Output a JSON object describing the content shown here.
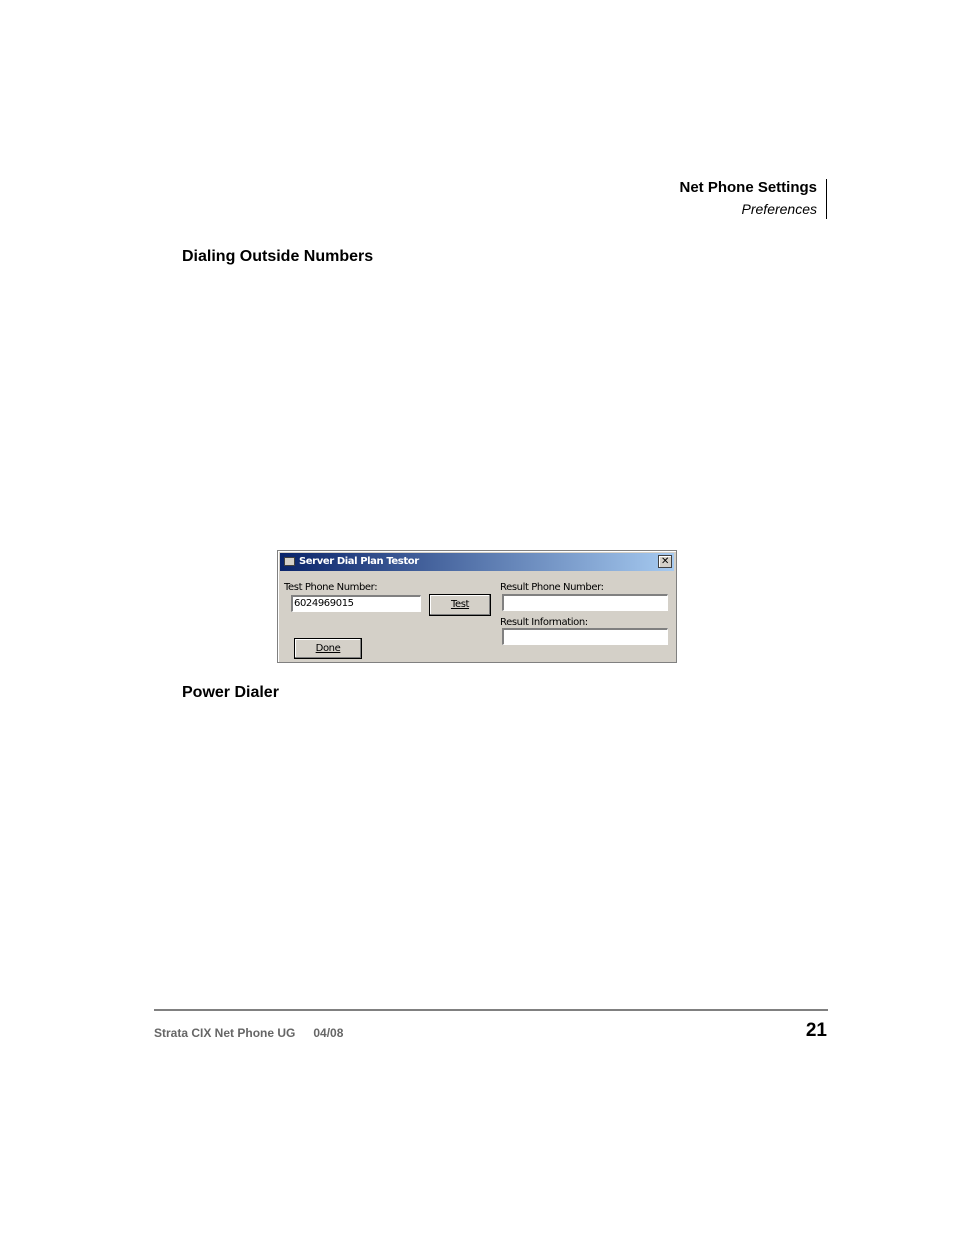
{
  "header": {
    "title": "Net Phone Settings",
    "subtitle": "Preferences"
  },
  "sections": [
    {
      "heading": "Dialing Outside Numbers"
    },
    {
      "heading": "Power Dialer"
    }
  ],
  "dialog": {
    "title": "Server Dial Plan Testor",
    "close_glyph": "✕",
    "test_phone_label": "Test Phone Number:",
    "test_phone_value": "6024969015",
    "test_button": "Test",
    "result_phone_label": "Result Phone Number:",
    "result_phone_value": "",
    "result_info_label": "Result Information:",
    "result_info_value": "",
    "done_button": "Done",
    "colors": {
      "titlebar_start": "#0a246a",
      "titlebar_end": "#a6caf0",
      "face": "#d4d0c8"
    }
  },
  "footer": {
    "doc_title": "Strata CIX Net Phone UG",
    "date": "04/08",
    "page_number": "21"
  }
}
